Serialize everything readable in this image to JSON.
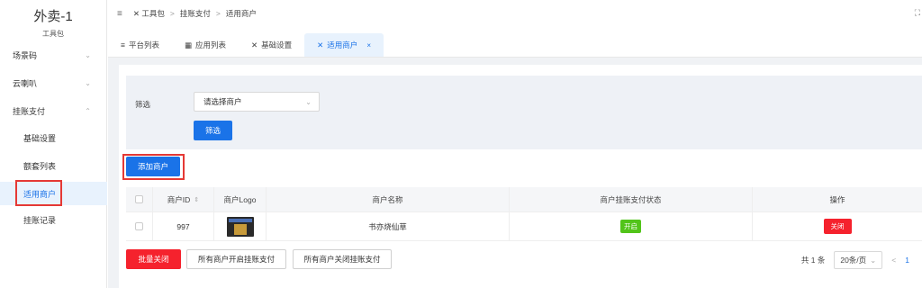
{
  "app": {
    "title": "外卖-1",
    "subtitle": "工具包"
  },
  "sidebar": {
    "items": [
      {
        "label": "场景码"
      },
      {
        "label": "云喇叭"
      },
      {
        "label": "挂账支付"
      },
      {
        "label": "基础设置"
      },
      {
        "label": "额套列表"
      },
      {
        "label": "适用商户"
      },
      {
        "label": "挂账记录"
      }
    ]
  },
  "breadcrumb": {
    "root": "工具包",
    "level2": "挂账支付",
    "current": "适用商户"
  },
  "tabs": [
    {
      "label": "平台列表"
    },
    {
      "label": "应用列表"
    },
    {
      "label": "基础设置"
    },
    {
      "label": "适用商户"
    }
  ],
  "filter": {
    "label": "筛选",
    "placeholder": "请选择商户",
    "button": "筛选"
  },
  "actions": {
    "add": "添加商户"
  },
  "table": {
    "headers": [
      "商户ID",
      "商户Logo",
      "商户名称",
      "商户挂账支付状态",
      "操作"
    ],
    "rows": [
      {
        "id": "997",
        "name": "书亦烧仙草",
        "status": "开启",
        "action": "关闭"
      }
    ]
  },
  "bulk": {
    "close": "批量关闭",
    "open_all": "所有商户开启挂账支付",
    "close_all": "所有商户关闭挂账支付"
  },
  "pager": {
    "total": "共 1 条",
    "size": "20条/页",
    "prev": "<",
    "page": "1"
  },
  "colors": {
    "primary": "#1a73e8",
    "danger": "#f5222d",
    "success": "#52c41a",
    "highlight": "#e53935"
  }
}
